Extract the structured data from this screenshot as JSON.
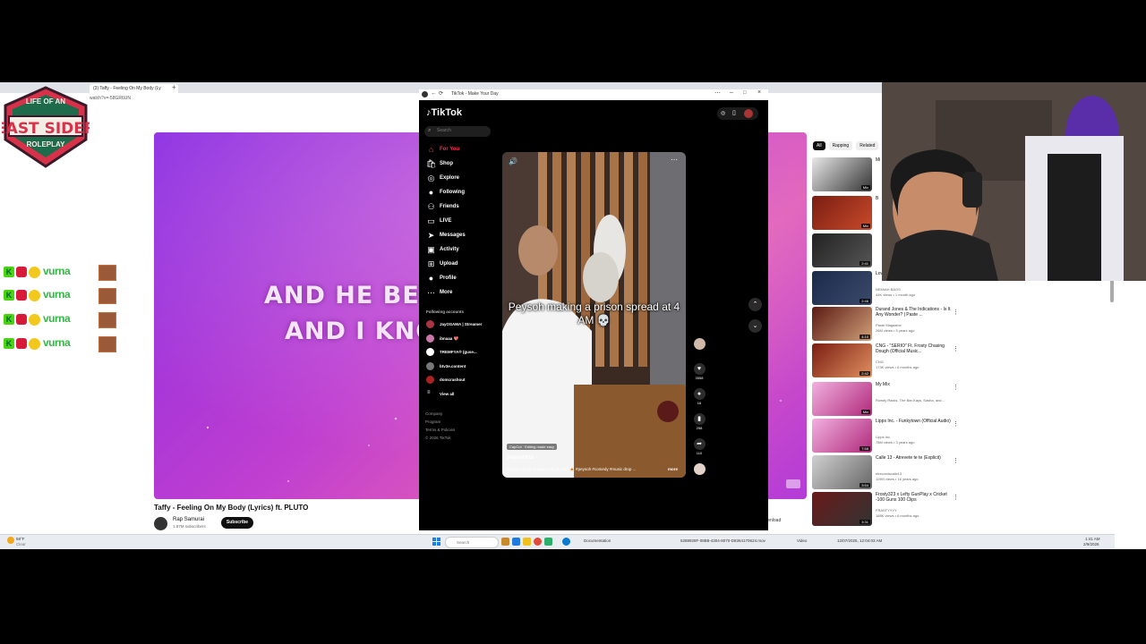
{
  "browser": {
    "tab_title": "(3) Taffy - Feeling On My Body (Ly",
    "url": "watch?v=-58GR6UN",
    "yt_title": "Taffy - Feeling On My Body (Lyrics) ft. PLUTO",
    "channel": "Rap Samurai",
    "subs": "1.87M subscribers",
    "subscribe": "Subscribe",
    "download": "Download",
    "lyric_line1": "AND HE BE L",
    "lyric_line2": "AND I KNO",
    "chips": [
      "All",
      "Rapping",
      "Related"
    ]
  },
  "overlay": {
    "logo_top": "LIFE OF AN",
    "logo_main": "EAST SIDER",
    "logo_sub": "ROLEPLAY",
    "chat_name": "vurna",
    "chat_rows": 4
  },
  "recommendations": [
    {
      "title": "Mi",
      "channel": "",
      "meta": "",
      "duration": "Mix",
      "colors": [
        "#e8e8e8",
        "#333"
      ]
    },
    {
      "title": "B",
      "channel": "",
      "meta": "",
      "duration": "Mix",
      "colors": [
        "#7a1d12",
        "#c84a2a"
      ]
    },
    {
      "title": "",
      "channel": "",
      "meta": "",
      "duration": "2:41",
      "colors": [
        "#222",
        "#555"
      ]
    },
    {
      "title": "Love (Official Music Video)",
      "channel": "NEMIAH BAGS",
      "meta": "44K views • 1 month ago",
      "duration": "2:46",
      "colors": [
        "#1c2a4a",
        "#3b4a6b"
      ]
    },
    {
      "title": "Durand Jones & The Indications - Is It Any Wonder? | Paste ...",
      "channel": "Paste Magazine",
      "meta": "26M views • 5 years ago",
      "duration": "4:10",
      "colors": [
        "#5a1a12",
        "#d1a07a"
      ]
    },
    {
      "title": "CNG - \"SERIO\" Ft. Frosty Chasing Dough (Official Music...",
      "channel": "CNG",
      "meta": "173K views • 6 months ago",
      "duration": "2:42",
      "colors": [
        "#7a1e12",
        "#e09060"
      ]
    },
    {
      "title": "My Mix",
      "channel": "Rowdy Racks, The Bar-Kays, Sasha, and...",
      "meta": "",
      "duration": "Mix",
      "colors": [
        "#f2b0e0",
        "#b02a7a"
      ]
    },
    {
      "title": "Lipps Inc. - Funkytown (Official Audio)",
      "channel": "Lipps Inc.",
      "meta": "78M views • 3 years ago",
      "duration": "7:58",
      "colors": [
        "#f2b0e0",
        "#b02a7a"
      ]
    },
    {
      "title": "Calle 13 - Atrevete te te (Explicit)",
      "channel": "elrecordscalle13",
      "meta": "119M views • 16 years ago",
      "duration": "3:54",
      "colors": [
        "#d0d0d0",
        "#666"
      ]
    },
    {
      "title": "Frosty323 x Lefty GunPlay x Cricket -100 Guns 100 Clips",
      "channel": "FRASTYYYY",
      "meta": "188K views • 6 months ago",
      "duration": "3:31",
      "colors": [
        "#6a1a1a",
        "#333"
      ]
    }
  ],
  "tiktok": {
    "window_title": "TikTok - Make Your Day",
    "logo": "TikTok",
    "search_placeholder": "Search",
    "nav": [
      {
        "label": "For You",
        "icon": "home-icon",
        "glyph": "⌂",
        "active": true
      },
      {
        "label": "Shop",
        "icon": "shop-icon",
        "glyph": "🛍",
        "active": false
      },
      {
        "label": "Explore",
        "icon": "compass-icon",
        "glyph": "◎",
        "active": false
      },
      {
        "label": "Following",
        "icon": "following-icon",
        "glyph": "●",
        "active": false
      },
      {
        "label": "Friends",
        "icon": "friends-icon",
        "glyph": "⚇",
        "active": false
      },
      {
        "label": "LIVE",
        "icon": "live-icon",
        "glyph": "▭",
        "active": false
      },
      {
        "label": "Messages",
        "icon": "messages-icon",
        "glyph": "➤",
        "active": false
      },
      {
        "label": "Activity",
        "icon": "activity-icon",
        "glyph": "▣",
        "active": false
      },
      {
        "label": "Upload",
        "icon": "upload-icon",
        "glyph": "⊞",
        "active": false
      },
      {
        "label": "Profile",
        "icon": "profile-icon",
        "glyph": "●",
        "active": false
      },
      {
        "label": "More",
        "icon": "more-icon",
        "glyph": "⋯",
        "active": false
      }
    ],
    "following_header": "Following accounts",
    "following": [
      "JayOSAMA | Streamer",
      "ibnaaa 💖",
      "TREMFYA® (guse...",
      "btv3e.content",
      "domcrashout"
    ],
    "view_all": "View all",
    "footer": [
      "Company",
      "Program",
      "Terms & Policies",
      "© 2026 TikTok"
    ],
    "caption": "Peysoh making a prison spread at 4 AM 💀",
    "capcut": "CapCut · Editing made easy",
    "username": "peysohfits",
    "description": "Peysoh doing random stuff at 4AM 🍝 #peysoh #comedy #music drop ...",
    "more": "more",
    "actions": [
      {
        "icon": "like-icon",
        "glyph": "♥",
        "count": "3558"
      },
      {
        "icon": "comment-icon",
        "glyph": "●",
        "count": "16"
      },
      {
        "icon": "bookmark-icon",
        "glyph": "▮",
        "count": "258"
      },
      {
        "icon": "share-icon",
        "glyph": "➦",
        "count": "110"
      }
    ]
  },
  "taskbar": {
    "search": "Search",
    "documentation": "Documentation",
    "file": "5288928F-08B8-4304-8070-D8364170624.mov",
    "video_label": "Video",
    "datetime": "12/07/2025, 12:04:03 AM",
    "weather": "58°F",
    "weather_sub": "Clear",
    "clock_time": "1:41 AM",
    "clock_date": "2/9/2026"
  }
}
